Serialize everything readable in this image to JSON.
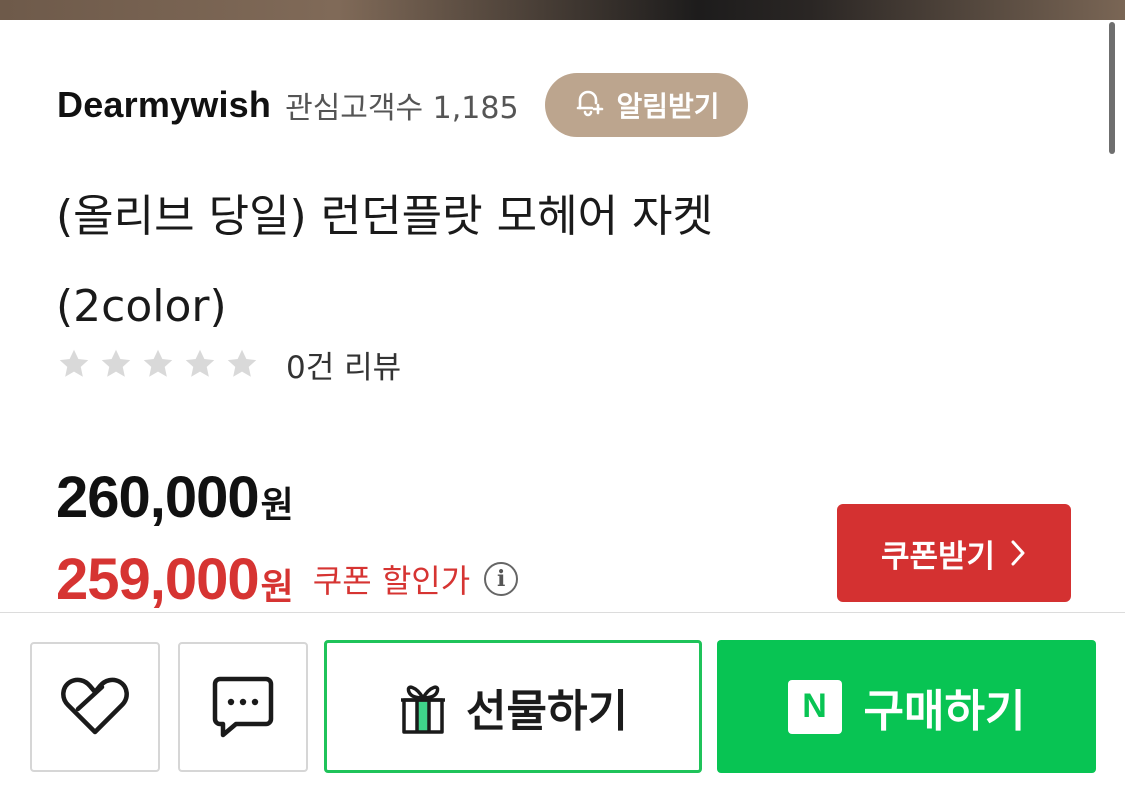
{
  "store": {
    "name": "Dearmywish",
    "followers_label": "관심고객수 1,185",
    "notify_label": "알림받기"
  },
  "product": {
    "title_line1": "(올리브 당일) 런던플랏 모헤어 자켓",
    "title_line2": "(2color)",
    "rating": 0,
    "rating_max": 5,
    "review_label": "0건 리뷰"
  },
  "pricing": {
    "price": "260,000",
    "sale_price": "259,000",
    "currency_unit": "원",
    "sale_label": "쿠폰 할인가",
    "info_symbol": "i",
    "coupon_button_label": "쿠폰받기"
  },
  "bottom_bar": {
    "gift_label": "선물하기",
    "buy_label": "구매하기",
    "naver_logo_letter": "N"
  },
  "icons": {
    "notify": "bell-plus-icon",
    "wishlist": "heart-outline-icon",
    "chat": "chat-bubble-icon",
    "gift": "gift-box-icon",
    "coupon_arrow": "chevron-right-icon",
    "info": "info-icon"
  },
  "colors": {
    "notify_bg": "#bca58e",
    "sale_red": "#d63432",
    "coupon_bg": "#d43131",
    "naver_green": "#08c453",
    "gift_border": "#1fc35a",
    "star_empty": "#d9d9d9"
  }
}
